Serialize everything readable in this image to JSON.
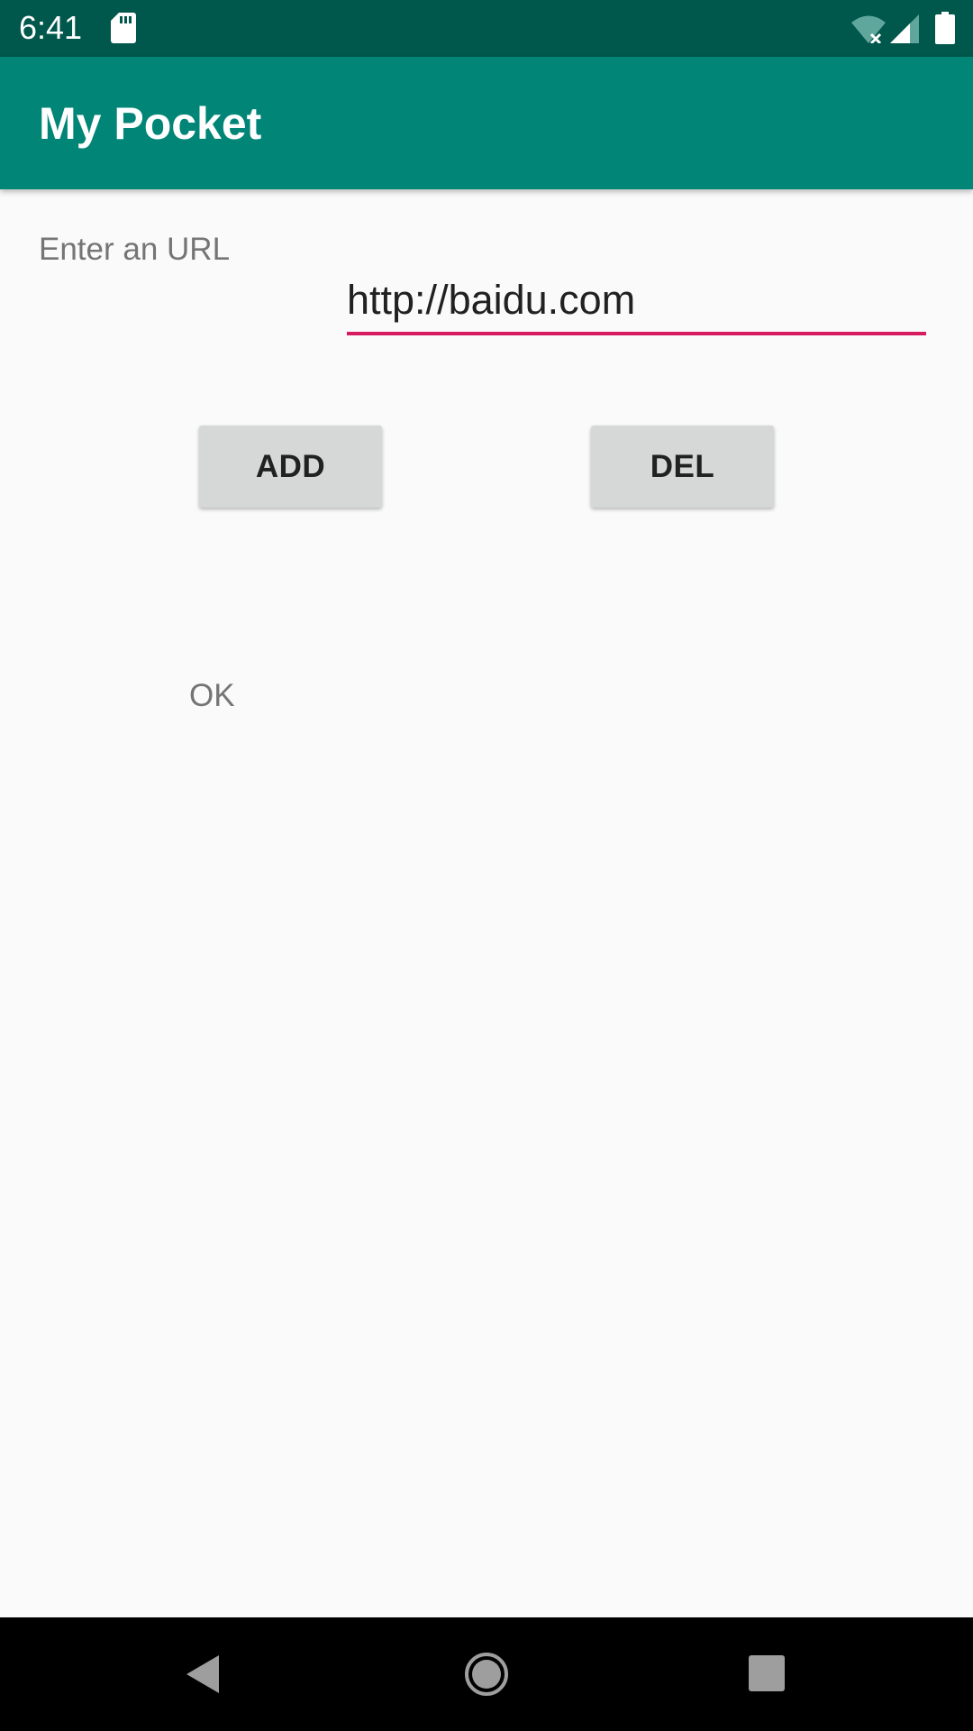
{
  "status_bar": {
    "time": "6:41",
    "icons": [
      "sd-card-icon",
      "wifi-off-icon",
      "signal-icon",
      "battery-icon"
    ]
  },
  "app_bar": {
    "title": "My Pocket",
    "color": "#008577"
  },
  "form": {
    "url_label": "Enter an URL",
    "url_value": "http://baidu.com",
    "accent_color": "#d81b60"
  },
  "buttons": {
    "add_label": "ADD",
    "del_label": "DEL"
  },
  "result": {
    "text": "OK"
  },
  "nav_bar": {
    "icons": [
      "back-icon",
      "home-icon",
      "recents-icon"
    ]
  }
}
